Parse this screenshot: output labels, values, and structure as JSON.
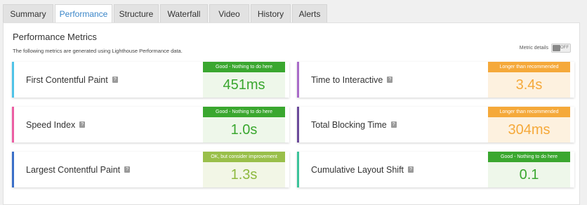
{
  "tabs": [
    {
      "label": "Summary",
      "active": false
    },
    {
      "label": "Performance",
      "active": true
    },
    {
      "label": "Structure",
      "active": false
    },
    {
      "label": "Waterfall",
      "active": false
    },
    {
      "label": "Video",
      "active": false
    },
    {
      "label": "History",
      "active": false
    },
    {
      "label": "Alerts",
      "active": false
    }
  ],
  "panel": {
    "title": "Performance Metrics",
    "subtitle": "The following metrics are generated using Lighthouse Performance data.",
    "metric_details_label": "Metric details",
    "toggle_state": "OFF"
  },
  "help_glyph": "?",
  "metrics": [
    {
      "name": "First Contentful Paint",
      "status": "Good - Nothing to do here",
      "value": "451ms",
      "accent": "#4fc3e8",
      "status_bg": "#3aa72f",
      "value_bg": "#eef7ea",
      "value_color": "#3aa72f"
    },
    {
      "name": "Time to Interactive",
      "status": "Longer than recommended",
      "value": "3.4s",
      "accent": "#a96bc9",
      "status_bg": "#f5a93a",
      "value_bg": "#fdf1df",
      "value_color": "#f5a93a"
    },
    {
      "name": "Speed Index",
      "status": "Good - Nothing to do here",
      "value": "1.0s",
      "accent": "#ec5ea3",
      "status_bg": "#3aa72f",
      "value_bg": "#eef7ea",
      "value_color": "#3aa72f"
    },
    {
      "name": "Total Blocking Time",
      "status": "Longer than recommended",
      "value": "304ms",
      "accent": "#6b4a9a",
      "status_bg": "#f5a93a",
      "value_bg": "#fdf1df",
      "value_color": "#f5a93a"
    },
    {
      "name": "Largest Contentful Paint",
      "status": "OK, but consider improvement",
      "value": "1.3s",
      "accent": "#3a6fc8",
      "status_bg": "#99bf4a",
      "value_bg": "#f2f6e6",
      "value_color": "#8db93e"
    },
    {
      "name": "Cumulative Layout Shift",
      "status": "Good - Nothing to do here",
      "value": "0.1",
      "accent": "#3cc39a",
      "status_bg": "#3aa72f",
      "value_bg": "#eef7ea",
      "value_color": "#3aa72f"
    }
  ]
}
